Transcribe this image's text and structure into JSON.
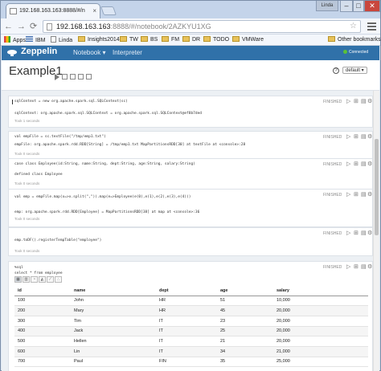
{
  "browser": {
    "tab_title": "192.168.163.163:8888/#/n",
    "user_label": "Linda",
    "address": {
      "host": "192.168.163.163",
      "path": ":8888/#/notebook/2AZKYU1XG"
    },
    "bookmarks": [
      "Apps",
      "IBM",
      "Linda",
      "Insights2014",
      "TW",
      "BS",
      "FM",
      "DR",
      "TODO",
      "VMWare"
    ],
    "other_bookmarks": "Other bookmarks"
  },
  "app": {
    "brand": "Zeppelin",
    "nav": {
      "notebook": "Notebook ▾",
      "interpreter": "Interpreter"
    },
    "connection_status": "Connected",
    "notebook_title": "Example1",
    "interpreter_select": "default ▾"
  },
  "paragraphs": [
    {
      "code": "sqlContext = new org.apache.spark.sql.SQLContext(sc)",
      "output": "sqlContext: org.apache.spark.sql.SQLContext = org.apache.spark.sql.SQLContext@ef8b7ded",
      "took": "Took 1 seconds",
      "status": "FINISHED"
    },
    {
      "code": "val empFile = sc.textFile(\"/tmp/emp1.txt\")",
      "output": "empFile: org.apache.spark.rdd.RDD[String] = /tmp/emp1.txt MapPartitionsRDD[30] at textFile at <console>:28",
      "took": "Took 0 seconds",
      "status": "FINISHED"
    },
    {
      "code": "case class Employee(id:String, name:String, dept:String, age:String, salary:String)",
      "output": "defined class Employee",
      "took": "Took 0 seconds",
      "status": "FINISHED"
    },
    {
      "code": "val emp = empFile.map(x=>x.split(\",\")).map(e=>Employee(e(0),e(1),e(2),e(3),e(4)))",
      "output": "emp: org.apache.spark.rdd.RDD[Employee] = MapPartitionsRDD[38] at map at <console>:36",
      "took": "Took 0 seconds",
      "status": "FINISHED"
    },
    {
      "code": "emp.toDF().registerTempTable(\"employee\")",
      "output": "",
      "took": "Took 0 seconds",
      "status": "FINISHED"
    },
    {
      "code": "%sql\nselect * from employee",
      "status": "FINISHED",
      "viz_buttons": [
        "table",
        "bar",
        "pie",
        "area",
        "line",
        "scatter"
      ],
      "table": {
        "columns": [
          "id",
          "name",
          "dept",
          "age",
          "salary"
        ],
        "rows": [
          [
            "100",
            "John",
            "HR",
            "51",
            "10,000"
          ],
          [
            "200",
            "Mary",
            "HR",
            "45",
            "20,000"
          ],
          [
            "300",
            "Tim",
            "IT",
            "23",
            "20,000"
          ],
          [
            "400",
            "Jack",
            "IT",
            "25",
            "20,000"
          ],
          [
            "500",
            "Hellen",
            "IT",
            "21",
            "20,000"
          ],
          [
            "600",
            "Lin",
            "IT",
            "34",
            "21,000"
          ],
          [
            "700",
            "Paul",
            "FIN",
            "35",
            "25,000"
          ]
        ]
      }
    }
  ]
}
